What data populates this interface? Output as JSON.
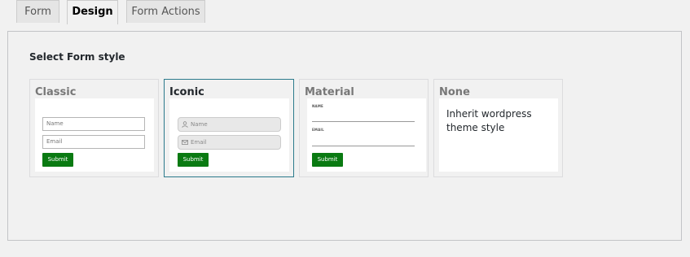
{
  "tabs": [
    {
      "label": "Form",
      "active": false
    },
    {
      "label": "Design",
      "active": true
    },
    {
      "label": "Form Actions",
      "active": false
    }
  ],
  "section_title": "Select Form style",
  "styles": {
    "classic": {
      "title": "Classic",
      "name_placeholder": "Name",
      "email_placeholder": "Email",
      "submit": "Submit"
    },
    "iconic": {
      "title": "Iconic",
      "name_placeholder": "Name",
      "email_placeholder": "Email",
      "submit": "Submit",
      "selected": true
    },
    "material": {
      "title": "Material",
      "name_label": "NAME",
      "email_label": "EMAIL",
      "submit": "Submit"
    },
    "none": {
      "title": "None",
      "description": "Inherit wordpress theme style"
    }
  },
  "colors": {
    "submit_button": "#0a7a12",
    "selected_border": "#2b7a8c"
  }
}
